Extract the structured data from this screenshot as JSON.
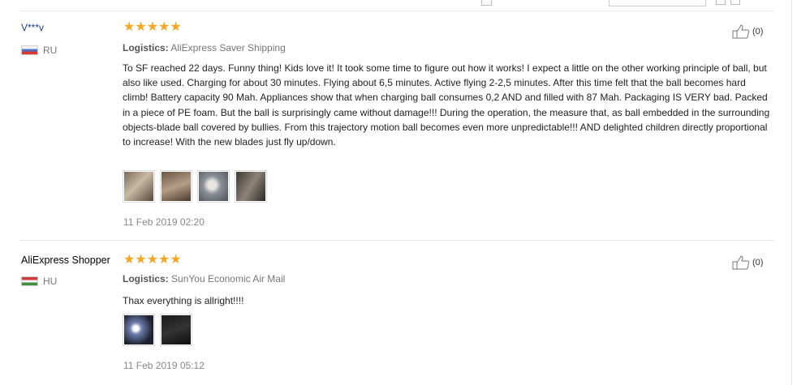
{
  "reviews": [
    {
      "user": "V***v",
      "country": "RU",
      "stars": "★★★★★",
      "logistics_label": "Logistics:",
      "logistics_value": "AliExpress Saver Shipping",
      "text": "To SF reached 22 days. Funny thing! Kids love it! It took some time to figure out how it works! I expect a little on the other working principle of ball, but also like used. Charging for about 30 minutes. Flying about 6,5 minutes. Active flying 2-2,5 minutes. After this time felt that the ball becomes hard climb! Battery capacity 90 Mah. Appliances show that when charging ball consumes 0,2 AND and filled with 87 Mah. Packaging IS VERY bad. Packed in a piece of PE foam. But the ball is surprisingly came without damage!!! During the operation, the measure that, as ball embedded in the surrounding objects-blade ball covered by bullies. From this trajectory motion ball becomes even more unpredictable!!! AND delighted children directly proportional to increase! With the new blades just fly up/down.",
      "date": "11 Feb 2019 02:20",
      "likes": "(0)",
      "flag_colors": [
        "#f4f4f4",
        "#4d73c4",
        "#d9392f"
      ]
    },
    {
      "user": "AliExpress Shopper",
      "country": "HU",
      "stars": "★★★★★",
      "logistics_label": "Logistics:",
      "logistics_value": "SunYou Economic Air Mail",
      "text": "Thax everything is allright!!!!",
      "date": "11 Feb 2019 05:12",
      "likes": "(0)",
      "flag_colors": [
        "#cf3a3a",
        "#f4f4f4",
        "#3f8f41"
      ]
    }
  ],
  "icons": {
    "like": "thumbs-up-icon"
  },
  "colors": {
    "star": "#f5a623",
    "username_link": "#1a3e8c"
  }
}
